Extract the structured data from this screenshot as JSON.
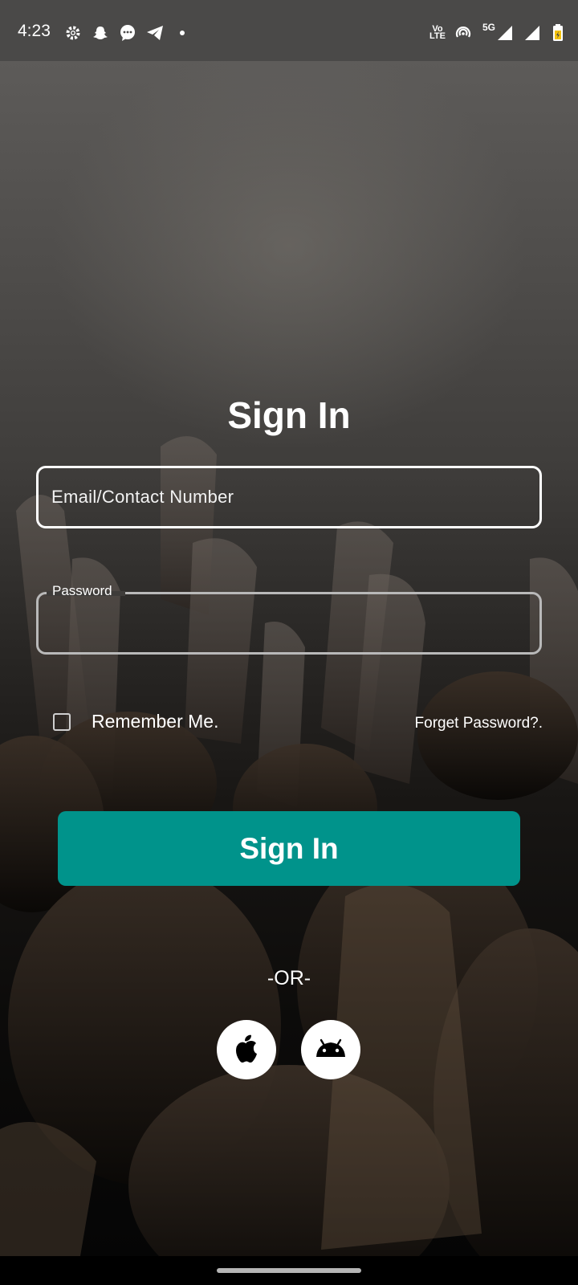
{
  "status_bar": {
    "time": "4:23",
    "left_icons": [
      "gear-icon",
      "snapchat-icon",
      "chat-bubble-icon",
      "telegram-icon",
      "dot-icon"
    ],
    "network_label": "5G",
    "volte_label_top": "Vo",
    "volte_label_bottom": "LTE"
  },
  "form": {
    "title": "Sign In",
    "email_placeholder": "Email/Contact Number",
    "password_label": "Password",
    "password_value": "",
    "remember_label": "Remember Me.",
    "remember_checked": false,
    "forget_label": "Forget Password?.",
    "signin_button": "Sign In",
    "or_text": "-OR-"
  },
  "social": {
    "items": [
      "apple-icon",
      "android-icon"
    ]
  },
  "colors": {
    "accent": "#00938b",
    "statusbar": "#4a4948",
    "text": "#ffffff"
  }
}
